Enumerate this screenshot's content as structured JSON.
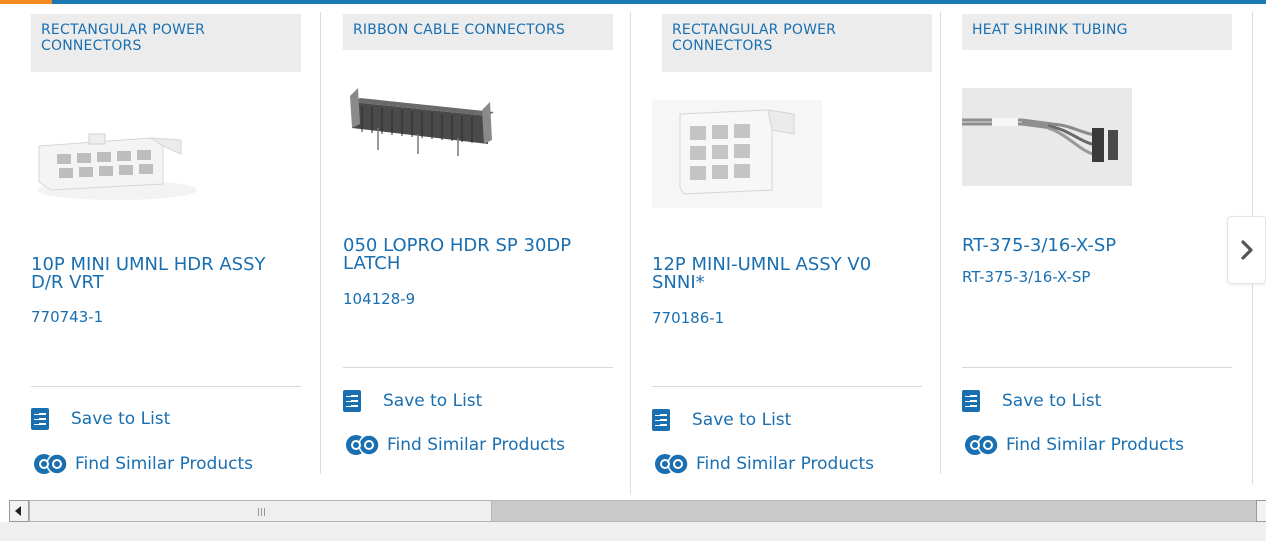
{
  "colors": {
    "brand_blue": "#1a6fb0",
    "accent_orange": "#f28a1e",
    "category_bg": "#ececec"
  },
  "cards": [
    {
      "category": "RECTANGULAR POWER CONNECTORS",
      "title": "10P MINI UMNL HDR ASSY D/R VRT",
      "part_number": "770743-1",
      "save_label": "Save to List",
      "similar_label": "Find Similar Products"
    },
    {
      "category": "RIBBON CABLE CONNECTORS",
      "title": "050 LOPRO HDR SP 30DP LATCH",
      "part_number": "104128-9",
      "save_label": "Save to List",
      "similar_label": "Find Similar Products"
    },
    {
      "category": "RECTANGULAR POWER CONNECTORS",
      "title": "12P MINI-UMNL ASSY V0 SNNI*",
      "part_number": "770186-1",
      "save_label": "Save to List",
      "similar_label": "Find Similar Products"
    },
    {
      "category": "HEAT SHRINK TUBING",
      "title": "RT-375-3/16-X-SP",
      "part_number": "RT-375-3/16-X-SP",
      "save_label": "Save to List",
      "similar_label": "Find Similar Products"
    }
  ],
  "icons": {
    "next": "chevron-right-icon",
    "save": "checklist-icon",
    "similar": "similar-products-icon"
  }
}
